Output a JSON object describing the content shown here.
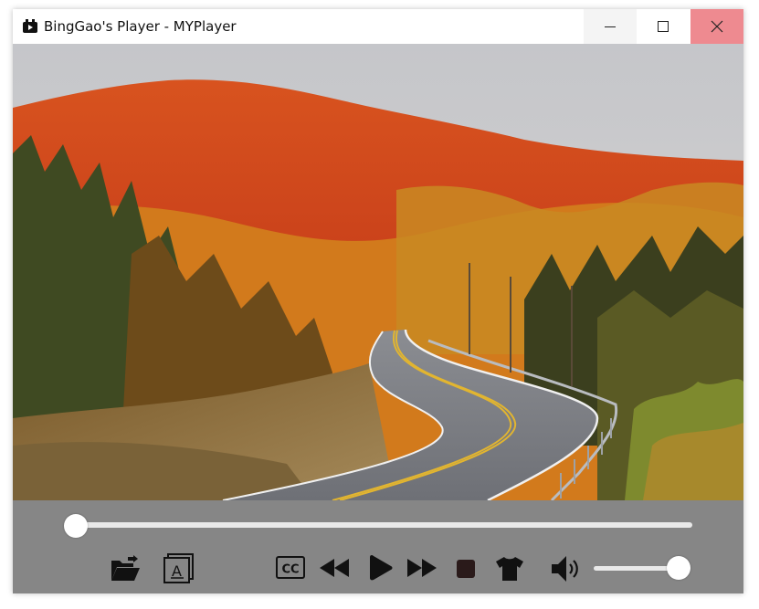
{
  "window": {
    "title": "BingGao's Player - MYPlayer",
    "min_glyph": "—",
    "max_glyph": "☐",
    "close_glyph": "✕"
  },
  "video": {
    "scene": "autumn-forest-winding-road"
  },
  "controls": {
    "seek_position": 0.0,
    "volume_level": 1.0,
    "icons": [
      "open-folder-icon",
      "subtitle-file-icon",
      "cc-icon",
      "rewind-icon",
      "play-icon",
      "fast-forward-icon",
      "stop-icon",
      "skin-shirt-icon",
      "volume-icon"
    ],
    "cc_text": "CC",
    "subtitle_letter": "A"
  },
  "colors": {
    "controls_bg": "#868686",
    "close_bg": "#ee8a90",
    "icon_color": "#111111",
    "stop_color": "#2a1a1a"
  }
}
